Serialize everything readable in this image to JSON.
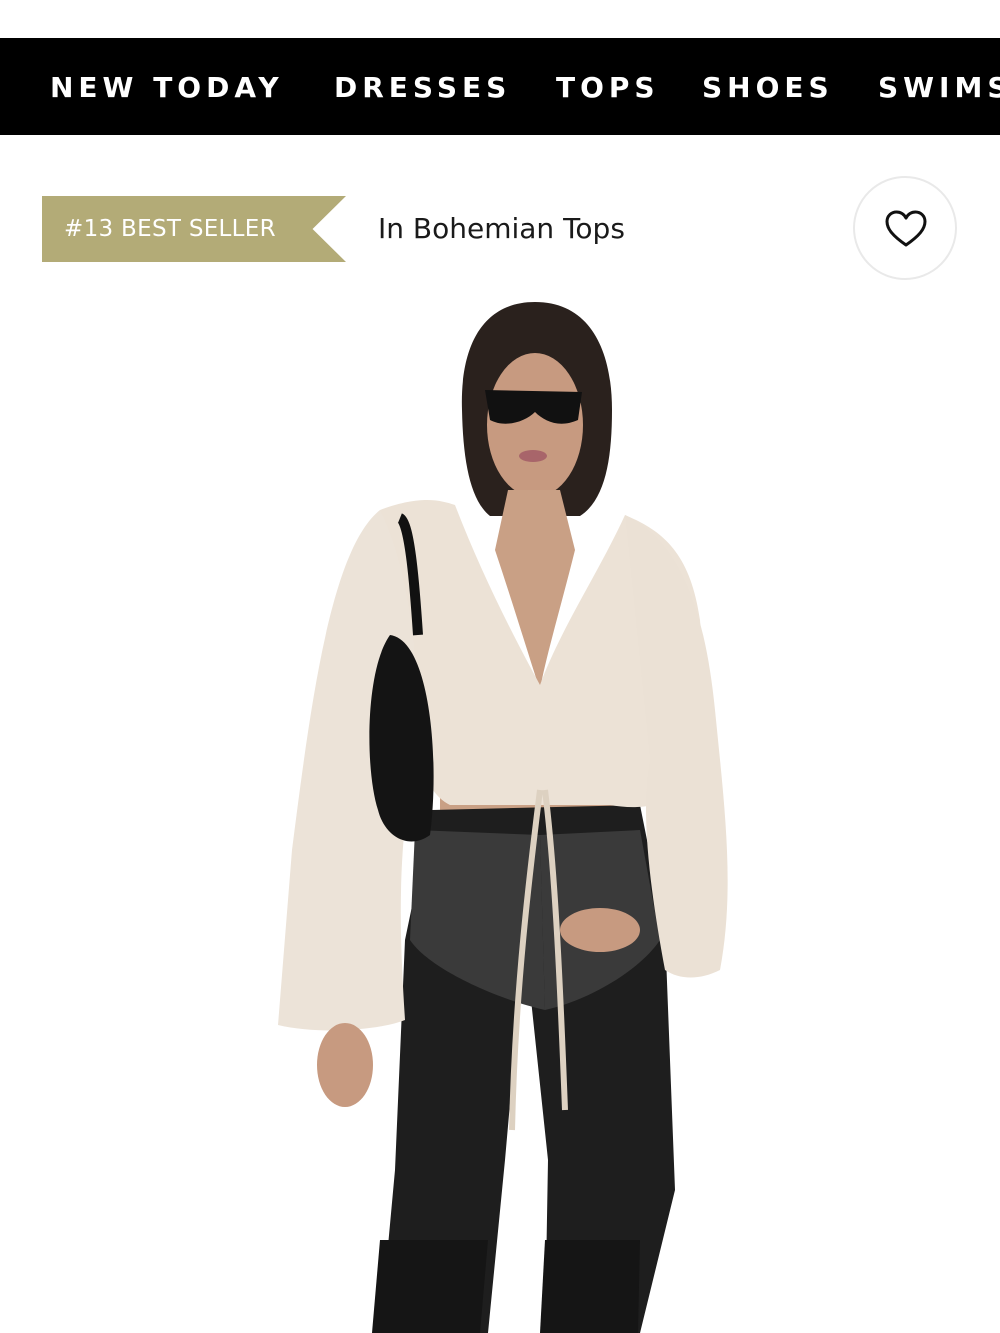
{
  "nav": {
    "items": [
      "NEW TODAY",
      "DRESSES",
      "TOPS",
      "SHOES",
      "SWIMS"
    ]
  },
  "badge": {
    "label": "#13 BEST SELLER",
    "category": "In Bohemian Tops",
    "color": "#b3ab77"
  },
  "wishlist": {
    "icon": "heart-icon"
  },
  "product": {
    "image": "model wearing sheer cream ruffle blouse with black leather fringe pants and shoulder bag"
  }
}
